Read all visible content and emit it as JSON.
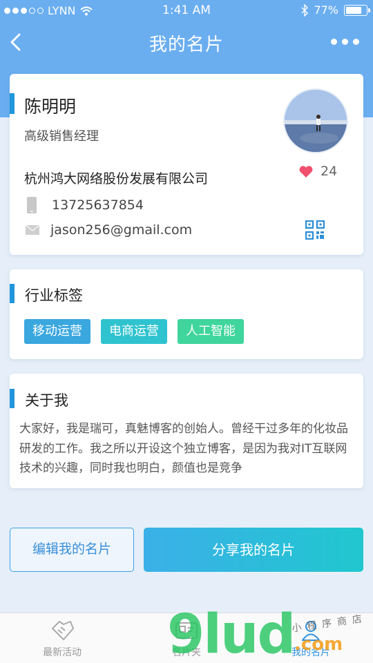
{
  "status_bar": {
    "carrier": "LYNN",
    "time": "1:41 AM",
    "battery_percent": "77%",
    "battery_level": 0.77
  },
  "nav": {
    "title": "我的名片",
    "back_icon": "chevron-left-icon",
    "more_icon": "more-dots-icon"
  },
  "profile": {
    "name": "陈明明",
    "job_title": "高级销售经理",
    "company": "杭州鸿大网络股份发展有限公司",
    "phone": "13725637854",
    "email": "jason256@gmail.com",
    "like_count": "24"
  },
  "tags_section": {
    "title": "行业标签",
    "tags": [
      {
        "label": "移动运营",
        "color": "#3aa7df"
      },
      {
        "label": "电商运营",
        "color": "#2fc3cf"
      },
      {
        "label": "人工智能",
        "color": "#3fd59c"
      }
    ]
  },
  "about_section": {
    "title": "关于我",
    "text": "大家好，我是瑞可，真魅博客的创始人。曾经干过多年的化妆品研发的工作。我之所以开设这个独立博客，是因为我对IT互联网技术的兴趣，同时我也明白，颜值也是竞争"
  },
  "actions": {
    "edit_label": "编辑我的名片",
    "share_label": "分享我的名片"
  },
  "tabbar": {
    "items": [
      {
        "label": "最新活动",
        "icon": "handshake-icon"
      },
      {
        "label": "名片夹",
        "icon": "card-holder-icon"
      },
      {
        "label": "我的名片",
        "icon": "person-icon"
      }
    ]
  },
  "watermark": {
    "big": "9lud",
    "suffix": ".com",
    "small": "小程序商店"
  },
  "colors": {
    "header_blue": "#6aaef0",
    "accent": "#2196db",
    "like_red": "#f0506e",
    "share_gradient_start": "#3bb0e8",
    "share_gradient_end": "#20c7cf"
  }
}
